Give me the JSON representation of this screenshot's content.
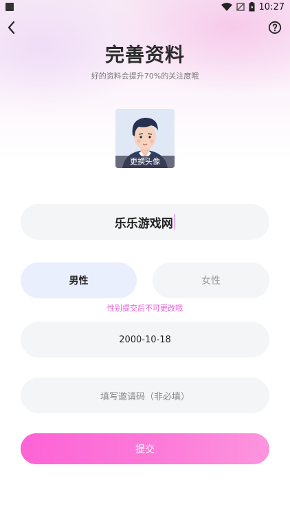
{
  "status_bar": {
    "time": "10:27"
  },
  "header": {
    "title": "完善资料",
    "subtitle": "好的资料会提升70%的关注度哦"
  },
  "avatar": {
    "label": "更换头像"
  },
  "form": {
    "nickname_value": "乐乐游戏网",
    "gender": {
      "male_label": "男性",
      "female_label": "女性",
      "selected": "男性"
    },
    "gender_note": "性别提交后不可更改哦",
    "birthday_value": "2000-10-18",
    "invite_placeholder": "填写邀请码（非必填）",
    "submit_label": "提交"
  },
  "colors": {
    "accent": "#fd63d5",
    "selected_gender_bg": "#e9effc",
    "note": "#e35ad2",
    "field_bg": "#f4f5f7"
  },
  "icons": [
    "back-arrow-icon",
    "help-icon",
    "wifi-icon",
    "no-sim-icon",
    "battery-icon"
  ]
}
